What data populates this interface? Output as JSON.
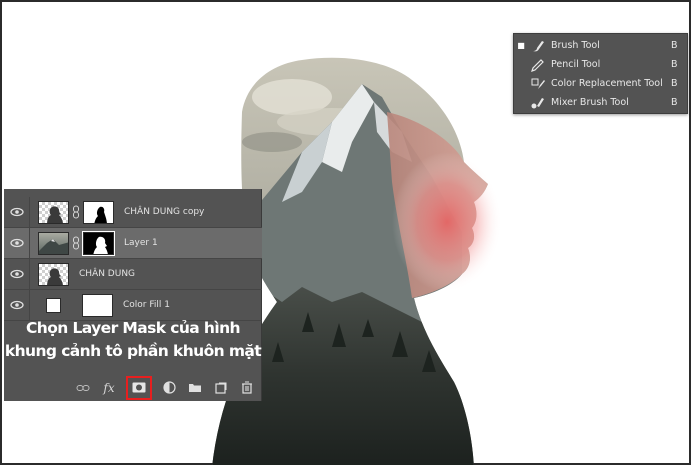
{
  "tool_menu": {
    "items": [
      {
        "label": "Brush Tool",
        "shortcut": "B",
        "active": true,
        "icon": "brush-icon"
      },
      {
        "label": "Pencil Tool",
        "shortcut": "B",
        "active": false,
        "icon": "pencil-icon"
      },
      {
        "label": "Color Replacement Tool",
        "shortcut": "B",
        "active": false,
        "icon": "color-replacement-icon"
      },
      {
        "label": "Mixer Brush Tool",
        "shortcut": "B",
        "active": false,
        "icon": "mixer-brush-icon"
      }
    ],
    "bullet": "■"
  },
  "layers": {
    "rows": [
      {
        "name": "CHÂN DUNG copy",
        "selected": false
      },
      {
        "name": "Layer 1",
        "selected": true
      },
      {
        "name": "CHÂN DUNG",
        "selected": false
      },
      {
        "name": "Color Fill 1",
        "selected": false
      }
    ],
    "instruction_line1": "Chọn Layer Mask của hình",
    "instruction_line2": "khung cảnh tô phần khuôn mặt",
    "footer_fx": "fx"
  },
  "colors": {
    "panel_bg": "#535353",
    "selected_row": "#6b6b6b",
    "highlight_box": "#e81f1f",
    "glow": "#e8505a"
  }
}
